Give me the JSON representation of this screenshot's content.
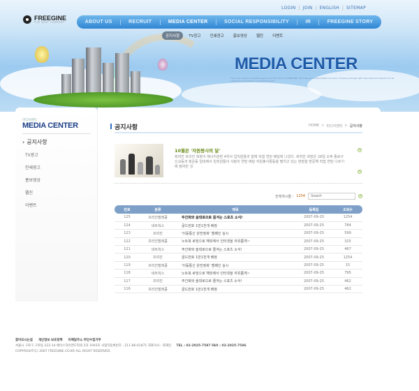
{
  "top_links": [
    "LOGIN",
    "JOIN",
    "ENGLISH",
    "SITEMAP"
  ],
  "logo": {
    "name": "FREEGINE",
    "tagline": "FOR BEST COMPANY"
  },
  "main_nav": [
    {
      "label": "ABOUT US",
      "active": false
    },
    {
      "label": "RECRUIT",
      "active": false
    },
    {
      "label": "MEDIA CENTER",
      "active": true
    },
    {
      "label": "SOCIAL RESPONSIBILITY",
      "active": false
    },
    {
      "label": "IR",
      "active": false
    },
    {
      "label": "FREEGINE STORY",
      "active": false
    }
  ],
  "sub_nav": [
    {
      "label": "공지사항",
      "active": true
    },
    {
      "label": "TV광고",
      "active": false
    },
    {
      "label": "인쇄광고",
      "active": false
    },
    {
      "label": "홍보영상",
      "active": false
    },
    {
      "label": "웹진",
      "active": false
    },
    {
      "label": "이벤트",
      "active": false
    }
  ],
  "banner": {
    "headline": "MEDIA CENTER",
    "tagline": "The most creative marketing agency for the future of FREEGINE. We make your brand better and your company stronger with new ideas and passion for all customers and partners around the world."
  },
  "sidebar": {
    "small_title": "미디어센터",
    "title": "MEDIA CENTER",
    "items": [
      "공지사항",
      "TV광고",
      "인쇄광고",
      "홍보영상",
      "웹진",
      "이벤트"
    ]
  },
  "content": {
    "page_title": "공지사항",
    "breadcrumb": [
      "HOME",
      ">",
      "미디어센터",
      ">",
      "공지사항"
    ],
    "feature": {
      "title": "10월은 '자원봉사의 달'",
      "text": "회려잔 프리진 회장이 에너지관련 4차사 입직원들과 함께 직접 연탄 배달에 나섰다. 회려잔 회장은 28일 오후 종로구 신교동과 청운동 일대에서 임직원들이 사랑의 연탄 배달 자원봉사활동을 펼치고 있는 현장을 방문해 직접 연탄 나르기에 참여한 것."
    },
    "total_label": "전체게시물 :",
    "total_count": "1254",
    "search_placeholder": "Search",
    "table": {
      "headers": [
        "번호",
        "분류",
        "제목",
        "등록일",
        "조회수"
      ],
      "rows": [
        {
          "no": "125",
          "cat": "프리진탤레콤",
          "title": "주간화와 술대로으로 즐겨는 스포츠 소식!",
          "date": "2007-09-25",
          "views": "1254",
          "bold": true
        },
        {
          "no": "124",
          "cat": "네트웍스",
          "title": "골드번호 1만1천개 배정",
          "date": "2007-09-25",
          "views": "784",
          "bold": false
        },
        {
          "no": "123",
          "cat": "프리진",
          "title": "'이동통신 완전정복' 캠페인 실시",
          "date": "2007-09-25",
          "views": "599",
          "bold": false
        },
        {
          "no": "122",
          "cat": "프리진탤레콤",
          "title": "노트북 로밍으로 해외에서 인터넷을 자유롭게~",
          "date": "2007-09-25",
          "views": "325",
          "bold": false
        },
        {
          "no": "121",
          "cat": "네트웍스",
          "title": "주간화와 술대로으로 즐겨는 스포츠 소식!",
          "date": "2007-09-25",
          "views": "467",
          "bold": false
        },
        {
          "no": "120",
          "cat": "프리진",
          "title": "골드번호 1만1천개 배정",
          "date": "2007-09-25",
          "views": "1254",
          "bold": false
        },
        {
          "no": "119",
          "cat": "프리진탤레콤",
          "title": "'이동통신 완전정복' 캠페인 실시",
          "date": "2007-09-25",
          "views": "15",
          "bold": false
        },
        {
          "no": "118",
          "cat": "네트웍스",
          "title": "노트북 로밍으로 해외에서 인터넷을 자유롭게~",
          "date": "2007-09-25",
          "views": "795",
          "bold": false
        },
        {
          "no": "117",
          "cat": "프리진",
          "title": "주간화와 술대로으로 즐겨는 스포츠 소식!",
          "date": "2007-09-25",
          "views": "462",
          "bold": false
        },
        {
          "no": "116",
          "cat": "프리진탤레콤",
          "title": "골드번호 1만1천개 배정",
          "date": "2007-09-25",
          "views": "462",
          "bold": false
        }
      ]
    }
  },
  "footer": {
    "links": [
      "찾아오시는길",
      "개인정보 보호정책",
      "이메일주소 무단수집거부"
    ],
    "address": "서울시 구로구 구로동 222-14 에이스하이엔드타워 2차 1003호 사업자등록번호 : 211-86-61871 대표이사 : 최재민",
    "tel": "TEL : 02-2025-7587   FAX : 02-2025-7586",
    "copyright": "COPYRIGHT(C) 2007 FREEGINE.CO.KR ALL RIGHT RESERVED."
  },
  "colors": {
    "nav_blue": "#2f86d4",
    "title_blue": "#1c3f86",
    "accent_green": "#6a8d1a",
    "table_head": "#7ea0c8"
  }
}
